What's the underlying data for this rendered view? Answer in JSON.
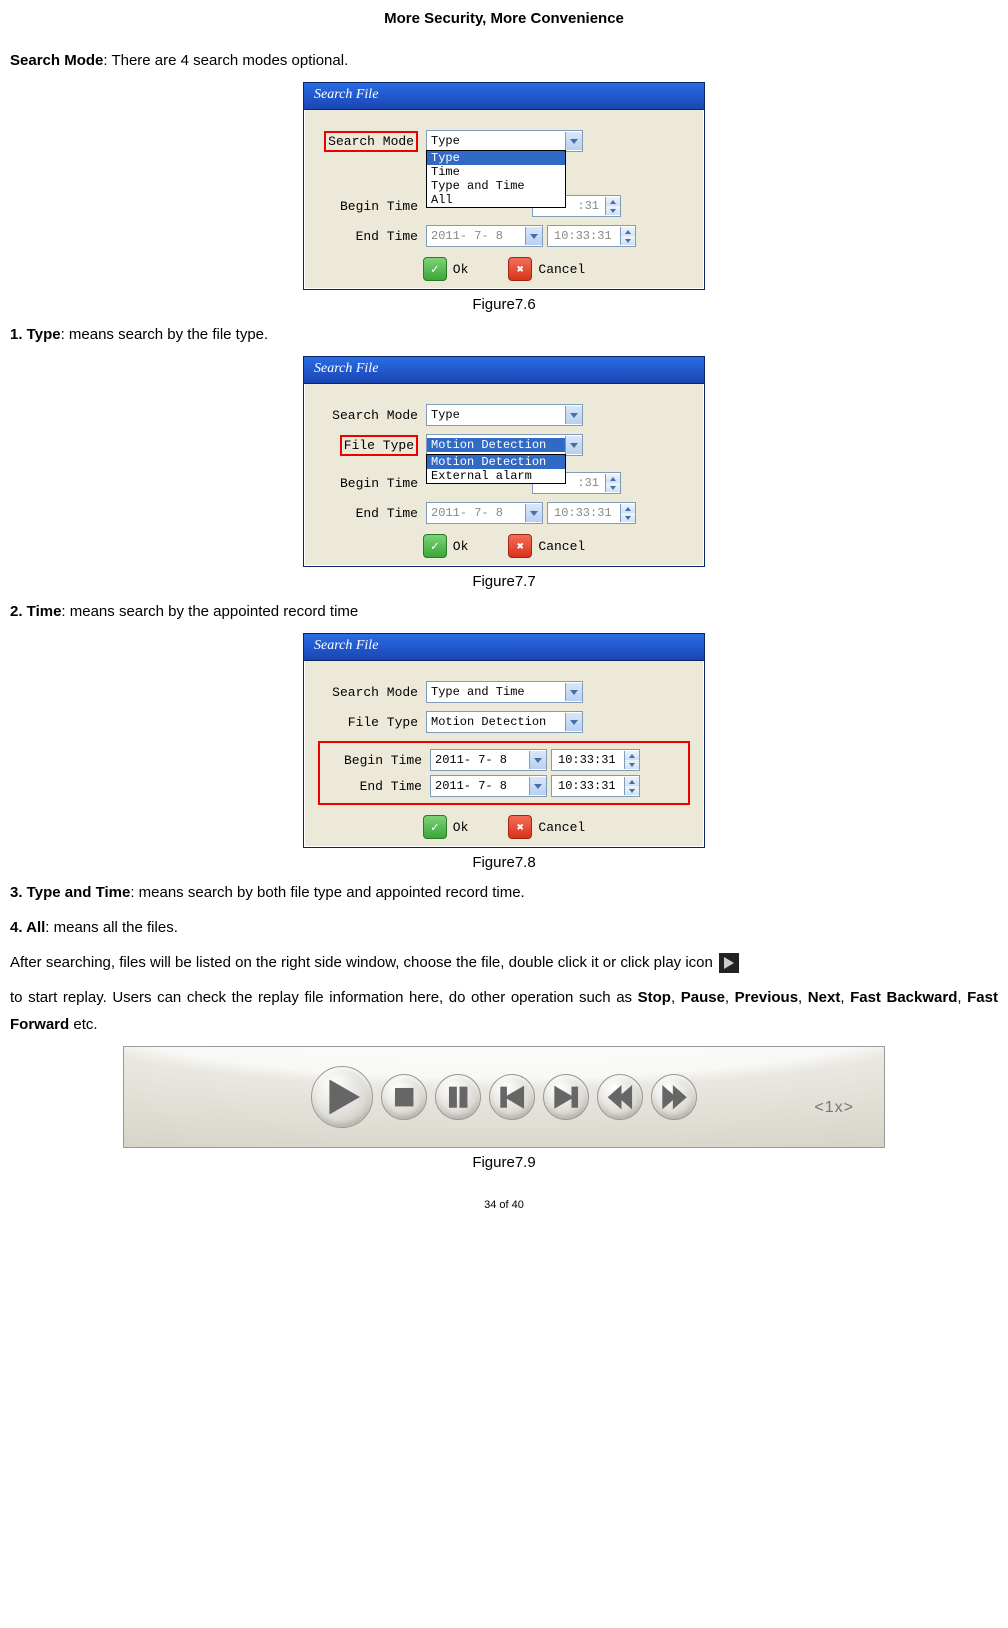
{
  "header": {
    "title": "More Security, More Convenience"
  },
  "intro": {
    "label": "Search Mode",
    "text": ": There are 4 search modes optional."
  },
  "dialog_common": {
    "title": "Search File",
    "labels": {
      "search_mode": "Search Mode",
      "file_type": "File Type",
      "begin_time": "Begin Time",
      "end_time": "End Time"
    },
    "buttons": {
      "ok": "Ok",
      "cancel": "Cancel"
    },
    "date": "2011- 7- 8",
    "time": "10:33:31",
    "time_fragment_right": ":31"
  },
  "fig76": {
    "caption": "Figure7.6",
    "combo_value": "Type",
    "dropdown": [
      "Type",
      "Time",
      "Type and Time",
      "All"
    ]
  },
  "text_type": {
    "label": "1. Type",
    "rest": ": means search by the file type."
  },
  "fig77": {
    "caption": "Figure7.7",
    "search_mode_value": "Type",
    "file_type_value": "Motion Detection",
    "dropdown": [
      "Motion Detection",
      "External alarm"
    ]
  },
  "text_time": {
    "label": "2. Time",
    "rest": ": means search by the appointed record time"
  },
  "fig78": {
    "caption": "Figure7.8",
    "search_mode_value": "Type and Time",
    "file_type_value": "Motion Detection"
  },
  "text_type_time": {
    "label": "3. Type and Time",
    "rest": ": means search by both file type and appointed record time."
  },
  "text_all": {
    "label": "4. All",
    "rest": ": means all the files."
  },
  "para_after": "After searching, files will be listed on the right side window, choose the file, double click it or click play icon",
  "para_after2_a": "to start replay. Users can check the replay file information here, do other operation such as ",
  "para_after2_b": "Stop",
  "para_after2_c": ", ",
  "para_after2_d": "Pause",
  "para_after2_e": ", ",
  "para_after2_f": "Previous",
  "para_after2_g": ", ",
  "para_after2_h": "Next",
  "para_after2_i": ", ",
  "para_after2_j": "Fast Backward",
  "para_after2_k": ", ",
  "para_after2_l": "Fast Forward",
  "para_after2_m": " etc.",
  "fig79": {
    "caption": "Figure7.9",
    "speed": "<1x>"
  },
  "footer": {
    "page": "34 of 40"
  }
}
